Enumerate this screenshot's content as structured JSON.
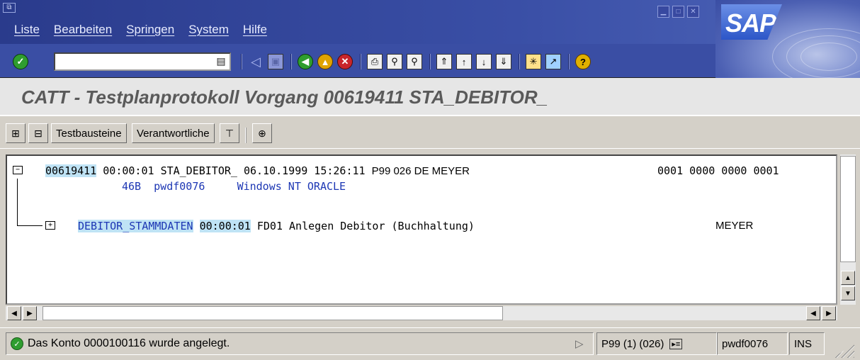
{
  "menu": {
    "items": [
      {
        "label": "Liste"
      },
      {
        "label": "Bearbeiten"
      },
      {
        "label": "Springen"
      },
      {
        "label": "System"
      },
      {
        "label": "Hilfe"
      }
    ]
  },
  "logo": {
    "text": "SAP"
  },
  "toolbar": {
    "command_field_value": "",
    "icons": [
      "enter-icon",
      "command-field-arrow-icon",
      "back-arrow-icon",
      "save-icon",
      "back-icon",
      "exit-icon",
      "cancel-icon",
      "print-icon",
      "find-icon",
      "find-next-icon",
      "first-page-icon",
      "previous-page-icon",
      "next-page-icon",
      "last-page-icon",
      "new-session-icon",
      "shortcut-icon",
      "help-icon"
    ]
  },
  "page": {
    "title": "CATT - Testplanprotokoll  Vorgang 00619411 STA_DEBITOR_"
  },
  "app_toolbar": {
    "testbausteine_label": "Testbausteine",
    "verantwortliche_label": "Verantwortliche"
  },
  "tree": {
    "root": {
      "id": "00619411",
      "duration": "00:00:01",
      "name": "STA_DEBITOR_",
      "datetime": "06.10.1999 15:26:11",
      "system": "P99 026 DE MEYER",
      "counts": "0001 0000 0000 0001",
      "release": "46B",
      "host": "pwdf0076",
      "os_db": "Windows NT ORACLE"
    },
    "child": {
      "name": "DEBITOR_STAMMDATEN",
      "duration": "00:00:01",
      "tcode_desc": "FD01 Anlegen Debitor (Buchhaltung)",
      "user": "MEYER"
    }
  },
  "status": {
    "message": "Das Konto 0000100116 wurde angelegt.",
    "system": "P99 (1) (026)",
    "server": "pwdf0076",
    "mode": "INS"
  },
  "colors": {
    "title_bar": "#2a3b8c",
    "highlight": "#bfe3f5",
    "link_blue": "#1d37b4",
    "ok_green": "#2f9d2f"
  }
}
